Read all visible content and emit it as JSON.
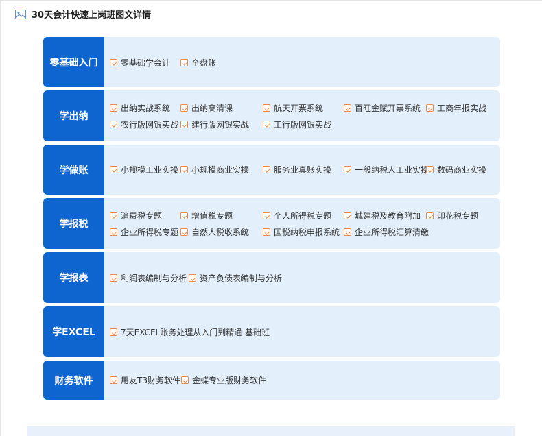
{
  "header": {
    "title": "30天会计快速上岗班图文详情",
    "icon": "image-icon"
  },
  "colors": {
    "label_bg": "#0f65d0",
    "row_bg": "#e3effa",
    "check": "#e88a4e"
  },
  "rows": [
    {
      "label": "零基础入门",
      "items": [
        "零基础学会计",
        "全盘账"
      ]
    },
    {
      "label": "学出纳",
      "items": [
        "出纳实战系统",
        "出纳高清课",
        "航天开票系统",
        "百旺金赋开票系统",
        "工商年报实战",
        "农行版网银实战",
        "建行版网银实战",
        "工行版网银实战"
      ]
    },
    {
      "label": "学做账",
      "items": [
        "小规模工业实操",
        "小规模商业实操",
        "服务业真账实操",
        "一般纳税人工业实操",
        "数码商业实操"
      ]
    },
    {
      "label": "学报税",
      "items": [
        "消费税专题",
        "增值税专题",
        "个人所得税专题",
        "城建税及教育附加",
        "印花税专题",
        "企业所得税专题",
        "自然人税收系统",
        "国税纳税申报系统",
        "企业所得税汇算清缴"
      ]
    },
    {
      "label": "学报表",
      "items": [
        "利润表编制与分析",
        "资产负债表编制与分析"
      ]
    },
    {
      "label": "学EXCEL",
      "items": [
        "7天EXCEL账务处理从入门到精通 基础班"
      ]
    },
    {
      "label": "财务软件",
      "items": [
        "用友T3财务软件",
        "金蝶专业版财务软件"
      ]
    }
  ]
}
